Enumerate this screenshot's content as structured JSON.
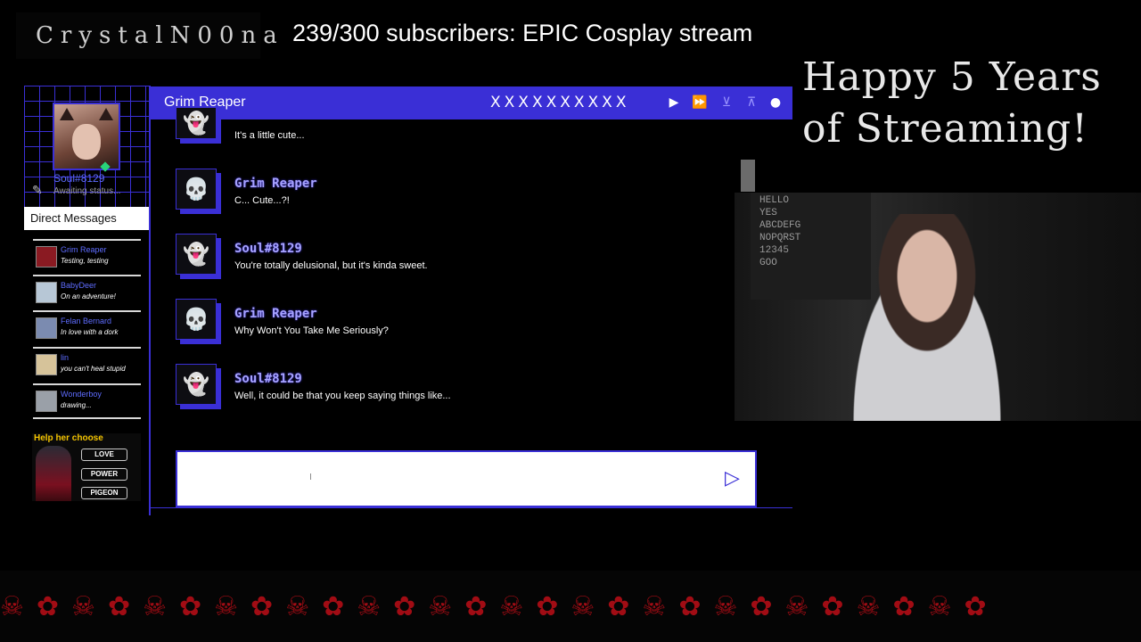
{
  "overlay": {
    "logo": "CrystalN00na",
    "goal": "239/300 subscribers: EPIC Cosplay stream",
    "anniversary": "Happy 5 Years of Streaming!"
  },
  "profile": {
    "username": "Soul#8129",
    "status": "Awaiting status..."
  },
  "sidebar": {
    "header": "Direct Messages",
    "items": [
      {
        "name": "Grim Reaper",
        "preview": "Testing, testing",
        "color": "#8a1a22"
      },
      {
        "name": "BabyDeer",
        "preview": "On an adventure!",
        "color": "#b7c7d6"
      },
      {
        "name": "Felan Bernard",
        "preview": "In love with a dork",
        "color": "#7b8bb0"
      },
      {
        "name": "lin",
        "preview": "you can't heal stupid",
        "color": "#d6c39a"
      },
      {
        "name": "Wonderboy",
        "preview": "drawing...",
        "color": "#9aa0a8"
      }
    ]
  },
  "choose": {
    "title": "Help her choose",
    "options": [
      "LOVE",
      "POWER",
      "PIGEON"
    ]
  },
  "chat": {
    "title": "Grim Reaper",
    "xs": "XXXXXXXXXX",
    "messages": [
      {
        "name": "",
        "text": "It's a little cute...",
        "avatar": "ghost"
      },
      {
        "name": "Grim Reaper",
        "text": "C... Cute...?!",
        "avatar": "skull"
      },
      {
        "name": "Soul#8129",
        "text": "You're totally delusional, but it's kinda sweet.",
        "avatar": "ghost"
      },
      {
        "name": "Grim Reaper",
        "text": "Why Won't You Take Me Seriously?",
        "avatar": "skull"
      },
      {
        "name": "Soul#8129",
        "text": "Well, it could be that you keep saying things like...",
        "avatar": "ghost"
      }
    ],
    "input_value": ""
  },
  "webcam": {
    "board_text": "HELLO\nYES\nABCDEFG\nNOPQRST\n12345\nGOO"
  },
  "colors": {
    "accent": "#3a2fd6",
    "name": "#a7a3ff",
    "footer": "#a10c14"
  }
}
